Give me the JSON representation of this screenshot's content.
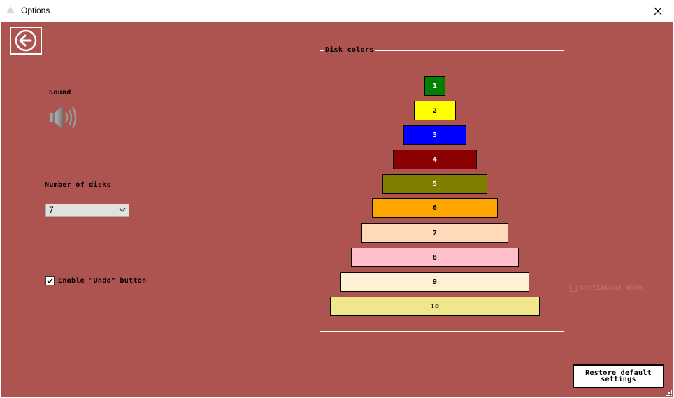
{
  "window": {
    "title": "Options"
  },
  "sound": {
    "label": "Sound"
  },
  "disks": {
    "label": "Number of disks",
    "selected": "7"
  },
  "undo": {
    "label": "Enable \"Undo\" button",
    "checked": true
  },
  "disk_colors": {
    "title": "Disk colors",
    "items": [
      {
        "label": "1",
        "color": "#008000",
        "text_color": "#ffffff"
      },
      {
        "label": "2",
        "color": "#ffff00",
        "text_color": "#000000"
      },
      {
        "label": "3",
        "color": "#0000ff",
        "text_color": "#ffffff"
      },
      {
        "label": "4",
        "color": "#8b0000",
        "text_color": "#ffffff"
      },
      {
        "label": "5",
        "color": "#808000",
        "text_color": "#ffffff"
      },
      {
        "label": "6",
        "color": "#ffa500",
        "text_color": "#000000"
      },
      {
        "label": "7",
        "color": "#ffdab9",
        "text_color": "#000000"
      },
      {
        "label": "8",
        "color": "#ffc0cb",
        "text_color": "#000000"
      },
      {
        "label": "9",
        "color": "#ffefd5",
        "text_color": "#000000"
      },
      {
        "label": "10",
        "color": "#f0e68c",
        "text_color": "#000000"
      }
    ]
  },
  "faded_option": {
    "label": "Continuous mode"
  },
  "restore": {
    "label": "Restore default settings"
  },
  "colors": {
    "background": "#ad5350"
  }
}
